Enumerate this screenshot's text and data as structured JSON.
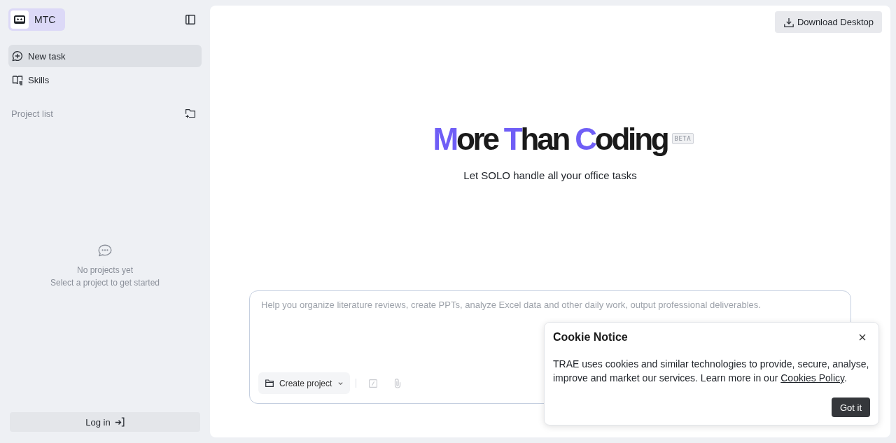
{
  "sidebar": {
    "brand": "MTC",
    "items": [
      {
        "label": "New task",
        "selected": true
      },
      {
        "label": "Skills",
        "selected": false
      }
    ],
    "section_title": "Project list",
    "empty_state": {
      "title": "No projects yet",
      "hint": "Select a project to get started"
    },
    "login_button": "Log in"
  },
  "header": {
    "download_button": "Download Desktop"
  },
  "hero": {
    "title_words": [
      {
        "initial": "M",
        "rest": "ore"
      },
      {
        "initial": "T",
        "rest": "han"
      },
      {
        "initial": "C",
        "rest": "oding"
      }
    ],
    "badge": "BETA",
    "subtitle": "Let SOLO handle all your office tasks"
  },
  "prompt": {
    "placeholder": "Help you organize literature reviews, create PPTs, analyze Excel data and other daily work, output professional deliverables.",
    "project_button": "Create project",
    "tools": [
      {
        "kind": "slash",
        "disabled": true
      },
      {
        "kind": "attach",
        "disabled": true
      }
    ]
  },
  "cookie_notice": {
    "title": "Cookie Notice",
    "text_before": "TRAE uses cookies and similar technologies to provide, secure, analyse, improve and market our services. Learn more in our ",
    "link": "Cookies Policy",
    "text_after": ".",
    "button": "Got it"
  }
}
